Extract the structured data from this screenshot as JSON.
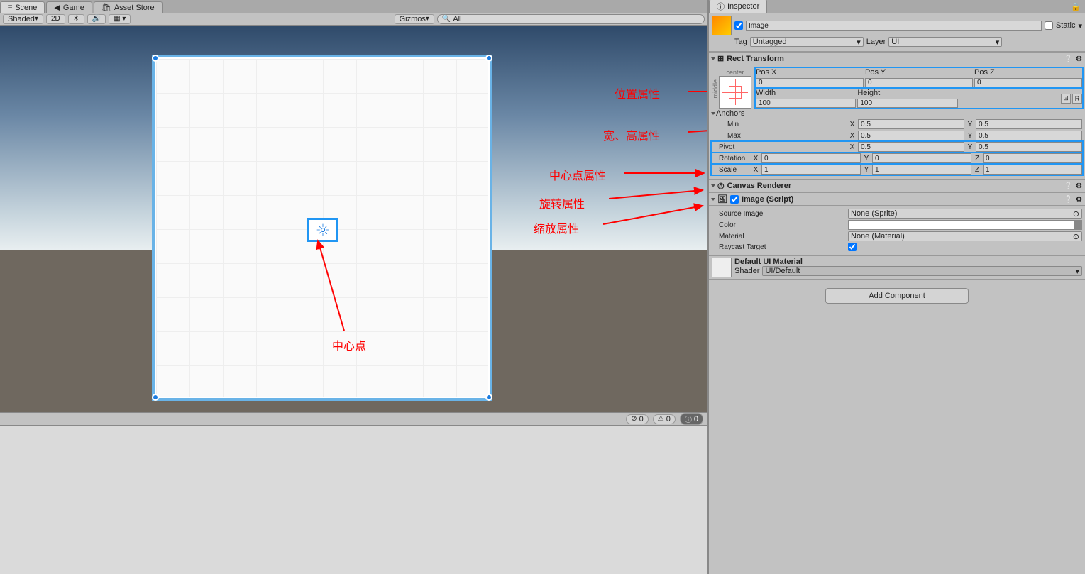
{
  "tabs": {
    "scene": "Scene",
    "game": "Game",
    "asset": "Asset Store",
    "inspector": "Inspector"
  },
  "toolbar": {
    "shaded": "Shaded",
    "mode2d": "2D",
    "gizmos": "Gizmos",
    "search": "All"
  },
  "status": {
    "err": "0",
    "warn": "0",
    "info": "0"
  },
  "obj": {
    "name": "Image",
    "static": "Static",
    "tag_lbl": "Tag",
    "tag": "Untagged",
    "layer_lbl": "Layer",
    "layer": "UI"
  },
  "rect": {
    "title": "Rect Transform",
    "center": "center",
    "middle": "middle",
    "posx": "Pos X",
    "posy": "Pos Y",
    "posz": "Pos Z",
    "px": "0",
    "py": "0",
    "pz": "0",
    "width": "Width",
    "height": "Height",
    "w": "100",
    "h": "100",
    "anchors": "Anchors",
    "min": "Min",
    "max": "Max",
    "minx": "0.5",
    "miny": "0.5",
    "maxx": "0.5",
    "maxy": "0.5",
    "pivot": "Pivot",
    "pvx": "0.5",
    "pvy": "0.5",
    "rotation": "Rotation",
    "rx": "0",
    "ry": "0",
    "rz": "0",
    "scale": "Scale",
    "sx": "1",
    "sy": "1",
    "sz": "1",
    "r": "R"
  },
  "canvas": {
    "title": "Canvas Renderer"
  },
  "img": {
    "title": "Image (Script)",
    "src": "Source Image",
    "srcv": "None (Sprite)",
    "color": "Color",
    "mat": "Material",
    "matv": "None (Material)",
    "ray": "Raycast Target"
  },
  "matl": {
    "title": "Default UI Material",
    "shader": "Shader",
    "shaderv": "UI/Default"
  },
  "add": "Add Component",
  "ann": {
    "pos": "位置属性",
    "wh": "宽、高属性",
    "pivot": "中心点属性",
    "rot": "旋转属性",
    "scale": "缩放属性",
    "center": "中心点"
  }
}
